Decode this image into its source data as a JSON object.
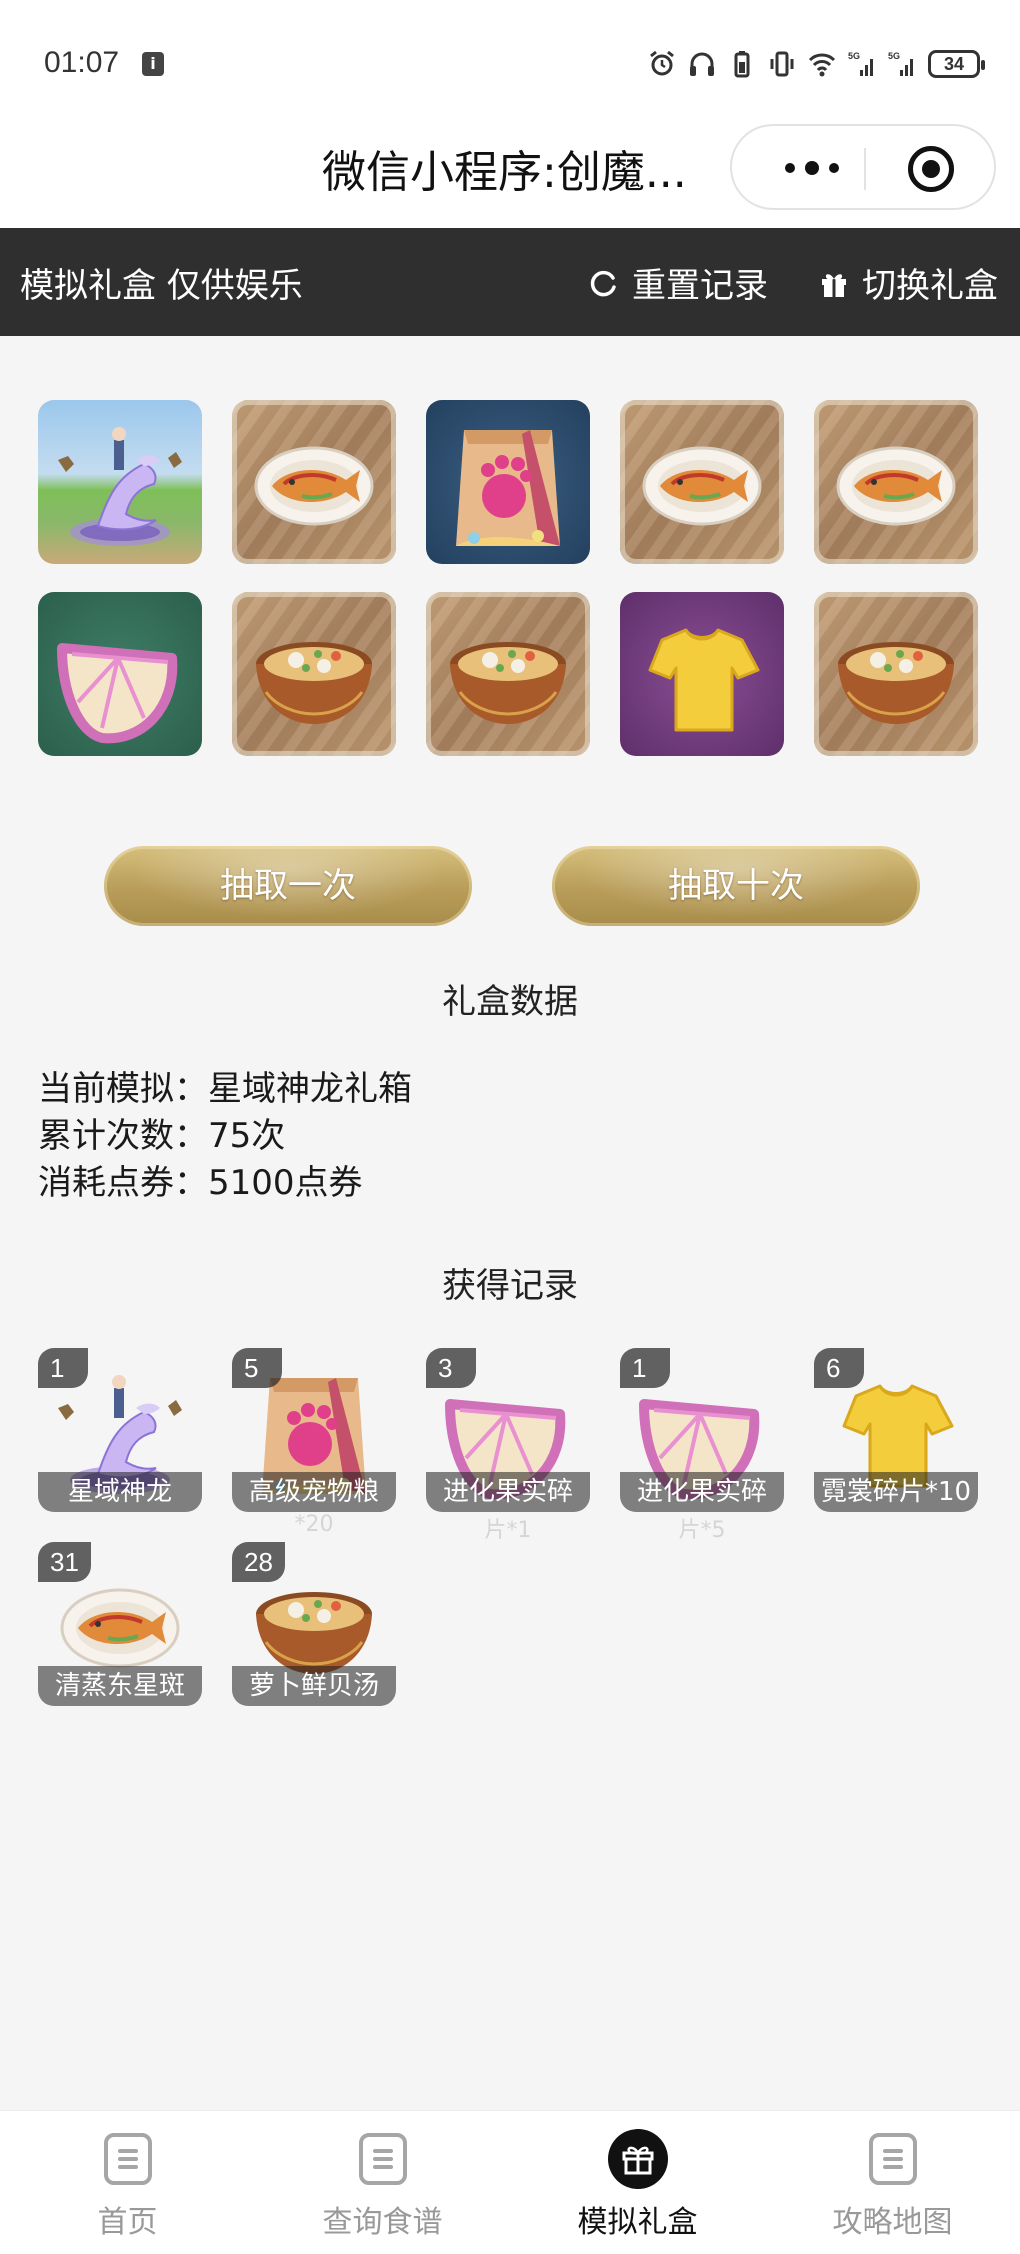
{
  "status": {
    "time": "01:07",
    "battery": "34"
  },
  "titlebar": {
    "title": "微信小程序:创魔..."
  },
  "header": {
    "left_label": "模拟礼盒 仅供娱乐",
    "reset_label": "重置记录",
    "switch_label": "切换礼盒"
  },
  "top_items": [
    {
      "icon": "dragon-mount-icon",
      "bg": "scene"
    },
    {
      "icon": "fish-dish-icon",
      "bg": "wood"
    },
    {
      "icon": "pet-food-bag-icon",
      "bg": "navy"
    },
    {
      "icon": "fish-dish-icon",
      "bg": "wood"
    },
    {
      "icon": "fish-dish-icon",
      "bg": "wood"
    },
    {
      "icon": "evolution-fruit-icon",
      "bg": "green"
    },
    {
      "icon": "soup-bowl-icon",
      "bg": "wood"
    },
    {
      "icon": "soup-bowl-icon",
      "bg": "wood"
    },
    {
      "icon": "outfit-fragment-icon",
      "bg": "purple"
    },
    {
      "icon": "soup-bowl-icon",
      "bg": "wood"
    }
  ],
  "buttons": {
    "draw_one": "抽取一次",
    "draw_ten": "抽取十次"
  },
  "box_data": {
    "title": "礼盒数据",
    "current_label": "当前模拟：",
    "current_value": "星域神龙礼箱",
    "count_label": "累计次数：",
    "count_value": "75次",
    "cost_label": "消耗点券：",
    "cost_value": "5100点券"
  },
  "records": {
    "title": "获得记录",
    "items": [
      {
        "count": "1",
        "name": "星域神龙",
        "sub": "",
        "icon": "dragon-mount-icon",
        "bg": "scene"
      },
      {
        "count": "5",
        "name": "高级宠物粮",
        "sub": "*20",
        "icon": "pet-food-bag-icon",
        "bg": "navy"
      },
      {
        "count": "3",
        "name": "进化果实碎",
        "sub": "片*1",
        "icon": "evolution-fruit-icon",
        "bg": "green"
      },
      {
        "count": "1",
        "name": "进化果实碎",
        "sub": "片*5",
        "icon": "evolution-fruit-icon",
        "bg": "green"
      },
      {
        "count": "6",
        "name": "霓裳碎片*10",
        "sub": "",
        "icon": "outfit-fragment-icon",
        "bg": "purple"
      },
      {
        "count": "31",
        "name": "清蒸东星斑",
        "sub": "",
        "icon": "fish-dish-icon",
        "bg": "wood"
      },
      {
        "count": "28",
        "name": "萝卜鲜贝汤",
        "sub": "",
        "icon": "soup-bowl-icon",
        "bg": "wood"
      }
    ]
  },
  "tabs": [
    {
      "label": "首页",
      "active": false
    },
    {
      "label": "查询食谱",
      "active": false
    },
    {
      "label": "模拟礼盒",
      "active": true
    },
    {
      "label": "攻略地图",
      "active": false
    }
  ],
  "colors": {
    "header_bg": "#2f2f2f",
    "button_gold": "#b89c58",
    "page_bg": "#f5f5f5"
  }
}
